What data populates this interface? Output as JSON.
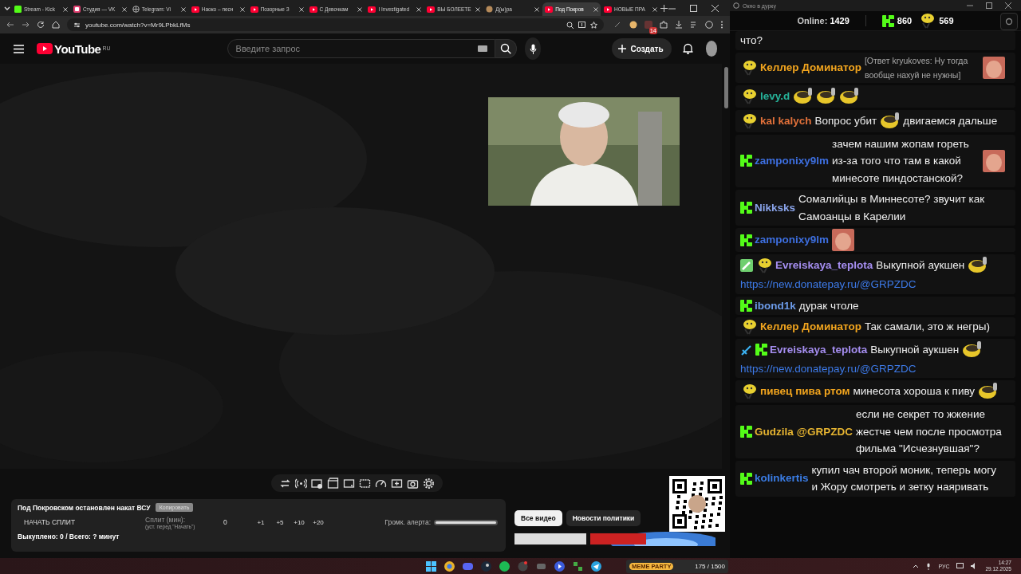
{
  "browser": {
    "tabs": [
      {
        "label": "Stream - Kick",
        "kind": "kick",
        "selected": false
      },
      {
        "label": "Студия — VK",
        "kind": "studio",
        "selected": false
      },
      {
        "label": "Telegram: Vi",
        "kind": "globe",
        "selected": false
      },
      {
        "label": "Наоко – песн",
        "kind": "video",
        "selected": false
      },
      {
        "label": "Позорные З",
        "kind": "video",
        "selected": false
      },
      {
        "label": "С Девочкам",
        "kind": "video",
        "selected": false
      },
      {
        "label": "I Investigated",
        "kind": "video",
        "selected": false
      },
      {
        "label": "ВЫ БОЛЕЕТЕ",
        "kind": "video",
        "selected": false
      },
      {
        "label": "Д(ы)ра",
        "kind": "creature",
        "selected": false
      },
      {
        "label": "Под Покров",
        "kind": "video",
        "selected": true
      },
      {
        "label": "НОВЫЕ ПРА",
        "kind": "video",
        "selected": false
      }
    ],
    "address": "youtube.com/watch?v=Mr9LPbkLfMs",
    "extension_badge": "14"
  },
  "youtube": {
    "logo": "YouTube",
    "region": "RU",
    "search": {
      "placeholder": "Введите запрос"
    },
    "create_button": "Создать"
  },
  "split_panel": {
    "title": "Под Покровском остановлен накат ВСУ",
    "copy_button": "Копировать",
    "start_button": "НАЧАТЬ СПЛИТ",
    "split_label": "Сплит (мин):",
    "split_hint": "(уст. перед \"Начать\")",
    "split_value": "0",
    "increments": [
      "+1",
      "+5",
      "+10",
      "+20"
    ],
    "alert_volume_label": "Громк. алерта:",
    "alert_volume": {
      "level": 1
    },
    "summary": "Выкуплено: 0 / Всего: ? минут"
  },
  "filter_chips": [
    {
      "label": "Все видео",
      "selected": true
    },
    {
      "label": "Новости политики",
      "selected": false
    }
  ],
  "chat": {
    "window_title": "Окно в дурку",
    "online_label": "Online:",
    "online": "1429",
    "kick_count": "860",
    "emote_count": "569",
    "messages": [
      {
        "parts": [
          {
            "kind": "text",
            "text": "что?"
          }
        ]
      },
      {
        "badges": [
          {
            "kind": "emote"
          }
        ],
        "user": "Келлер Доминатор",
        "color": "#f2a51e",
        "reply": "[Ответ kryukoves: Ну тогда вообще нахуй не нужны]",
        "parts": [
          {
            "kind": "image-emote"
          }
        ]
      },
      {
        "badges": [
          {
            "kind": "emote"
          }
        ],
        "user": "levy.d",
        "color": "#26b39a",
        "parts": [
          {
            "kind": "emote"
          },
          {
            "kind": "emote"
          },
          {
            "kind": "emote"
          }
        ]
      },
      {
        "badges": [
          {
            "kind": "emote"
          }
        ],
        "user": "kal kalych",
        "color": "#e2713a",
        "parts": [
          {
            "kind": "text",
            "text": "Вопрос убит"
          },
          {
            "kind": "emote"
          },
          {
            "kind": "text",
            "text": "двигаемся дальше"
          }
        ]
      },
      {
        "badges": [
          {
            "kind": "kick"
          }
        ],
        "user": "zamponixy9lm",
        "color": "#3d6fe0",
        "parts": [
          {
            "kind": "text",
            "text": "зачем нашим жопам гореть из-за того что там в какой минесоте пиндостанской?"
          },
          {
            "kind": "image-emote"
          }
        ]
      },
      {
        "badges": [
          {
            "kind": "kick"
          }
        ],
        "user": "Nikksks",
        "color": "#8aa4ea",
        "parts": [
          {
            "kind": "text",
            "text": "Сомалийцы в Миннесоте? звучит как Самоанцы в Карелии"
          }
        ]
      },
      {
        "badges": [
          {
            "kind": "kick"
          }
        ],
        "user": "zamponixy9lm",
        "color": "#3d6fe0",
        "parts": [
          {
            "kind": "image-emote"
          }
        ]
      },
      {
        "badges": [
          {
            "kind": "pencil"
          },
          {
            "kind": "emote"
          }
        ],
        "user": "Evreiskaya_teplota",
        "color": "#a58ef0",
        "parts": [
          {
            "kind": "text",
            "text": "Выкупной аукшен"
          },
          {
            "kind": "emote"
          },
          {
            "kind": "link",
            "text": "https://new.donatepay.ru/@GRPZDC"
          }
        ]
      },
      {
        "badges": [
          {
            "kind": "kick"
          }
        ],
        "user": "ibond1k",
        "color": "#6d9cea",
        "parts": [
          {
            "kind": "text",
            "text": "дурак чтоле"
          }
        ]
      },
      {
        "badges": [
          {
            "kind": "emote"
          }
        ],
        "user": "Келлер Доминатор",
        "color": "#f2a51e",
        "parts": [
          {
            "kind": "text",
            "text": "Так самали, это ж негры)"
          }
        ]
      },
      {
        "badges": [
          {
            "kind": "sword"
          },
          {
            "kind": "kick"
          }
        ],
        "user": "Evreiskaya_teplota",
        "color": "#a58ef0",
        "parts": [
          {
            "kind": "text",
            "text": "Выкупной аукшен"
          },
          {
            "kind": "emote"
          },
          {
            "kind": "link",
            "text": "https://new.donatepay.ru/@GRPZDC"
          }
        ]
      },
      {
        "badges": [
          {
            "kind": "emote"
          }
        ],
        "user": "пивец пива ртом",
        "color": "#f2a51e",
        "parts": [
          {
            "kind": "text",
            "text": "минесота хороша к пиву"
          },
          {
            "kind": "emote"
          }
        ]
      },
      {
        "badges": [
          {
            "kind": "kick"
          }
        ],
        "user": "Gudzila",
        "color": "#e6b431",
        "parts": [
          {
            "kind": "mention",
            "text": "@GRPZDC"
          },
          {
            "kind": "text",
            "text": "если не секрет то жжение жестче чем после просмотра фильма \"Исчезнувшая\"?"
          }
        ]
      },
      {
        "badges": [
          {
            "kind": "kick"
          }
        ],
        "user": "kolinkertis",
        "color": "#3a7de6",
        "parts": [
          {
            "kind": "text",
            "text": "купил чач второй моник, теперь могу и Жору смотреть и зетку наяривать"
          }
        ]
      }
    ]
  },
  "taskbar": {
    "widget": {
      "label": "MEME PARTY",
      "progress": "175 / 1500"
    },
    "language": "РУС",
    "time": "14:27",
    "date": "29.12.2025"
  }
}
